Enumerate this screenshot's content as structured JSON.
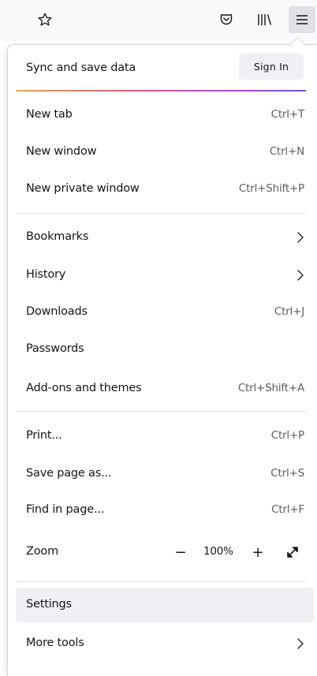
{
  "toolbar": {
    "icons": [
      "star-icon",
      "pocket-icon",
      "library-icon",
      "hamburger-menu-icon"
    ]
  },
  "sync": {
    "label": "Sync and save data",
    "sign_in": "Sign In"
  },
  "menu": {
    "new_tab": {
      "label": "New tab",
      "shortcut": "Ctrl+T"
    },
    "new_window": {
      "label": "New window",
      "shortcut": "Ctrl+N"
    },
    "new_private_window": {
      "label": "New private window",
      "shortcut": "Ctrl+Shift+P"
    },
    "bookmarks": {
      "label": "Bookmarks"
    },
    "history": {
      "label": "History"
    },
    "downloads": {
      "label": "Downloads",
      "shortcut": "Ctrl+J"
    },
    "passwords": {
      "label": "Passwords"
    },
    "addons": {
      "label": "Add-ons and themes",
      "shortcut": "Ctrl+Shift+A"
    },
    "print": {
      "label": "Print...",
      "shortcut": "Ctrl+P"
    },
    "save_page": {
      "label": "Save page as...",
      "shortcut": "Ctrl+S"
    },
    "find_in_page": {
      "label": "Find in page...",
      "shortcut": "Ctrl+F"
    },
    "zoom": {
      "label": "Zoom",
      "minus": "−",
      "value": "100%",
      "plus": "+"
    },
    "settings": {
      "label": "Settings"
    },
    "more_tools": {
      "label": "More tools"
    }
  },
  "colors": {
    "hover_bg": "#f0f0f4",
    "shortcut_text": "#5b5b66",
    "gradient": [
      "#ffa436",
      "#ff4a7a",
      "#b33fff",
      "#6d4aff"
    ]
  }
}
